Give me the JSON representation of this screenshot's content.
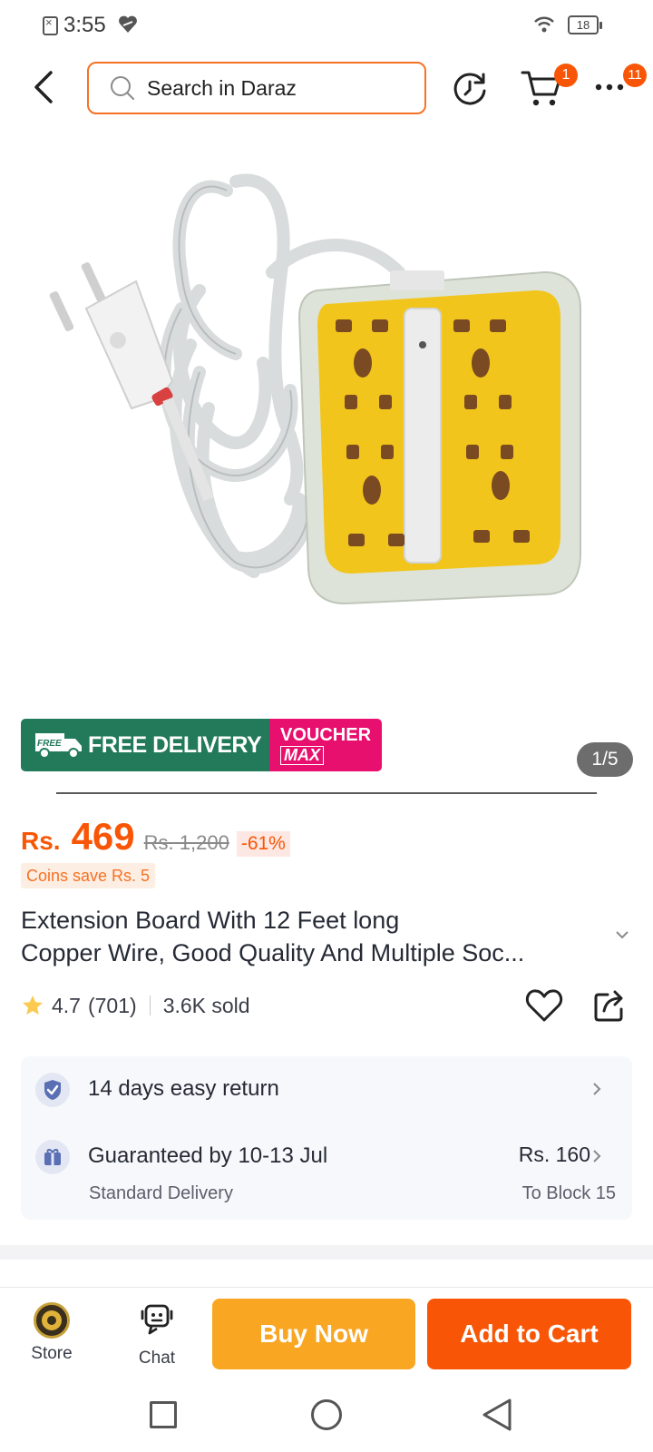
{
  "status_bar": {
    "time": "3:55",
    "battery": "18"
  },
  "header": {
    "search_placeholder": "Search in Daraz",
    "cart_badge": "1",
    "more_badge": "11"
  },
  "gallery": {
    "counter": "1/5"
  },
  "promo": {
    "free_label": "FREE",
    "free_delivery_text": "FREE DELIVERY",
    "voucher_top": "VOUCHER",
    "voucher_bottom": "MAX"
  },
  "price": {
    "currency": "Rs.",
    "value": "469",
    "original": "Rs. 1,200",
    "discount": "-61%",
    "coins": "Coins save Rs. 5"
  },
  "product": {
    "title_line1": "Extension Board With 12 Feet long",
    "title_line2": "Copper Wire, Good Quality And Multiple Soc..."
  },
  "rating": {
    "score": "4.7",
    "count": "(701)",
    "sold": "3.6K sold"
  },
  "delivery": {
    "return_text": "14 days easy return",
    "guarantee": "Guaranteed by 10-13 Jul",
    "type": "Standard Delivery",
    "fee": "Rs. 160",
    "location": "To Block 15"
  },
  "bottom_bar": {
    "store_label": "Store",
    "chat_label": "Chat",
    "buy_now": "Buy Now",
    "add_to_cart": "Add to Cart"
  },
  "colors": {
    "brand_orange": "#f85606",
    "buy_now_yellow": "#f9a623",
    "free_delivery_green": "#237a5b",
    "voucher_pink": "#e8106e"
  },
  "icons": [
    "back-arrow-icon",
    "search-icon",
    "history-icon",
    "cart-icon",
    "more-icon",
    "star-icon",
    "heart-icon",
    "share-icon",
    "shield-check-icon",
    "gift-icon",
    "chevron-right-icon",
    "chat-icon"
  ]
}
